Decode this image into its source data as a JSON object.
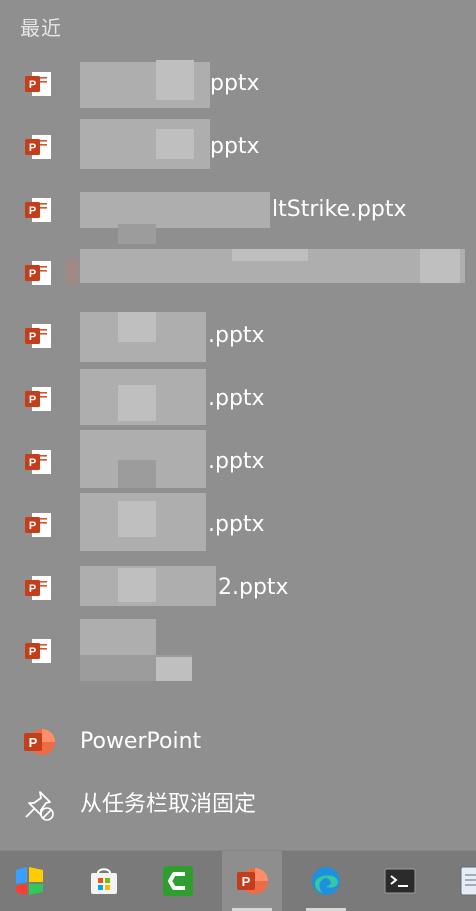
{
  "jumplist": {
    "section_title": "最近",
    "recent_files": [
      {
        "name": "pptx"
      },
      {
        "name": "pptx"
      },
      {
        "name": "ltStrike.pptx"
      },
      {
        "name": ""
      },
      {
        "name": ".pptx"
      },
      {
        "name": ".pptx"
      },
      {
        "name": ".pptx"
      },
      {
        "name": ".pptx"
      },
      {
        "name": "2.pptx"
      },
      {
        "name": ""
      }
    ],
    "app_label": "PowerPoint",
    "unpin_label": "从任务栏取消固定"
  },
  "taskbar": {
    "apps": [
      {
        "icon": "colorful-app-icon"
      },
      {
        "icon": "microsoft-store-icon"
      },
      {
        "icon": "camtasia-icon"
      },
      {
        "icon": "powerpoint-icon"
      },
      {
        "icon": "edge-icon"
      },
      {
        "icon": "terminal-icon"
      },
      {
        "icon": "notepad-icon"
      }
    ]
  },
  "colors": {
    "background": "#8f8f8f",
    "powerpoint": "#c43e1c",
    "taskbar": "#7a7a7a"
  }
}
